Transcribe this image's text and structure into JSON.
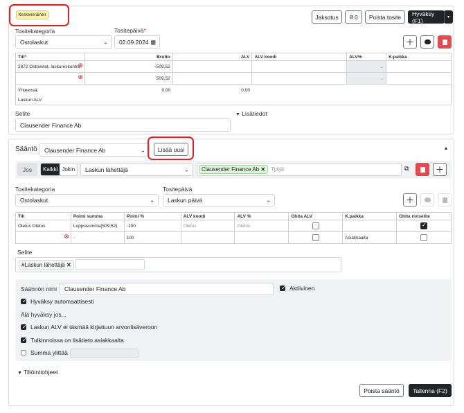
{
  "draft_badge": "Keskeneräinen",
  "top_actions": {
    "jaksotus": "Jaksotus",
    "attachments_count": "0",
    "delete_doc": "Poista tosite",
    "approve": "Hyväksy (F1)"
  },
  "voucher": {
    "category_label": "Tositekategoria",
    "category_value": "Ostolaskut",
    "date_label": "Tositepäivä",
    "date_required": "*",
    "date_value": "02.09.2024"
  },
  "table1": {
    "headers": [
      "Tili",
      "Brutto",
      "ALV",
      "ALV koodi",
      "ALV%",
      "K.paikka"
    ],
    "required_mark": "*",
    "rows": [
      {
        "account": "2872 Ostovelat, laskureskontra",
        "gross": "−509,52"
      },
      {
        "account": "",
        "gross": "509,52"
      }
    ],
    "totals_label": "Yhteensä:",
    "totals_gross": "0,00",
    "totals_alv": "0,00",
    "vat_label": "Laskun ALV"
  },
  "description": {
    "label": "Selite",
    "value": "Clausender Finance Ab",
    "extra_toggle": "Lisätiedot"
  },
  "rule": {
    "label": "Sääntö",
    "select_value": "Clausender Finance Ab",
    "add_new": "Lisää uusi",
    "condition": {
      "if_label": "Jos",
      "all": "Kaikki",
      "any": "Jokin",
      "field": "Laskun lähettäjä",
      "tag": "Clausender Finance Ab",
      "empty_placeholder": "Tyhjä"
    },
    "category_label": "Tositekategoria",
    "category_value": "Ostolaskut",
    "date_label": "Tositepäivä",
    "date_value": "Laskun päivä",
    "table": {
      "headers": [
        "Tili",
        "Poimi summa",
        "Poimi %",
        "ALV koodi",
        "ALV %",
        "Ohita ALV",
        "K.paikka",
        "Ohita riviselite"
      ],
      "rows": [
        {
          "account": "Oletus Oletus",
          "sum": "Loppusumma(509,52)",
          "pct": "-100",
          "alvcode": "Oletus",
          "alvpct": "Oletus",
          "kpaikka": ""
        },
        {
          "account": "",
          "sum": "-",
          "pct": "100",
          "alvcode": "",
          "alvpct": "",
          "kpaikka": "Asiakkaalta"
        }
      ]
    },
    "desc_label": "Selite",
    "desc_tag": "#Laskun lähettäjä",
    "name_label": "Säännön nimi",
    "name_value": "Clausender Finance Ab",
    "active_label": "Aktiivinen",
    "auto_approve": "Hyväksy automaattisesti",
    "dont_approve_if": "Älä hyväksy jos...",
    "cond1": "Laskun ALV ei täsmää kirjattuun arvonlisäveroon",
    "cond2": "Tulkinnoissa on lisätieto asiakkaalta",
    "cond3": "Summa ylittää",
    "instructions": "Tiliöintiohjeet",
    "delete_rule": "Poista sääntö",
    "save": "Tallenna (F2)"
  },
  "colors": {
    "accent_dark": "#212529",
    "danger": "#e5484d",
    "draft_badge_bg": "#fff3a8",
    "highlight": "#e02020"
  }
}
